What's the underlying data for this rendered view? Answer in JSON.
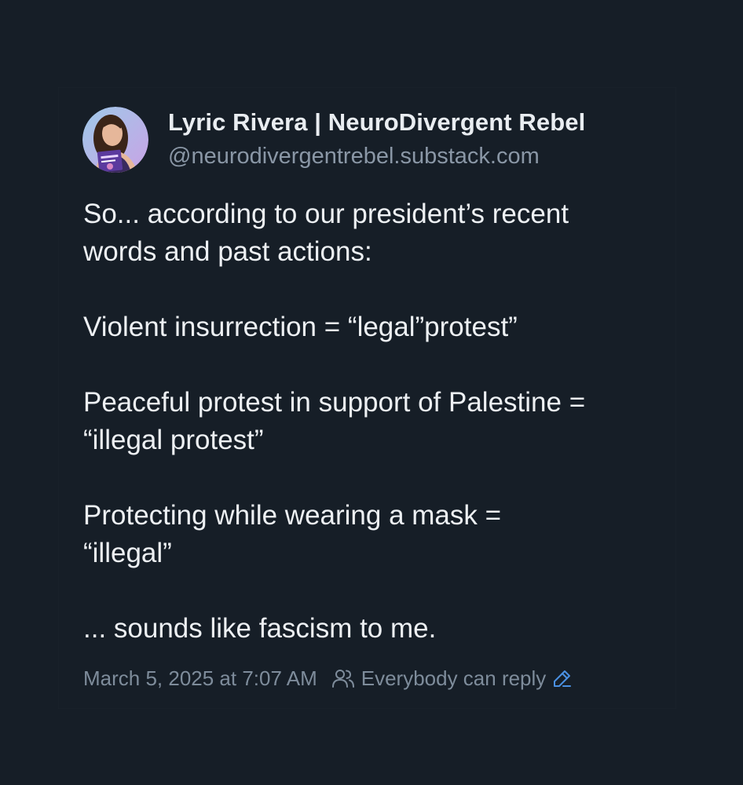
{
  "post": {
    "author": {
      "display_name": "Lyric Rivera | NeuroDivergent Rebel",
      "handle": "@neurodivergentrebel.substack.com"
    },
    "body": {
      "p1_line1": "So... according to our president’s recent",
      "p1_line2": "words and past actions:",
      "p2_line1": "Violent insurrection = “legal”protest”",
      "p3_line1": "Peaceful protest in support of Palestine =",
      "p3_line2": "“illegal protest”",
      "p4_line1": "Protecting while wearing a mask =",
      "p4_line2": "“illegal”",
      "p5_line1": "... sounds like fascism to me."
    },
    "footer": {
      "timestamp": "March 5, 2025 at 7:07 AM",
      "reply_setting": "Everybody can reply",
      "people_icon": "people-icon",
      "edit_icon": "pencil-icon"
    }
  },
  "colors": {
    "background": "#161e27",
    "text_primary": "#edf0f3",
    "text_secondary": "#8a97a6",
    "accent": "#4a90e2"
  }
}
